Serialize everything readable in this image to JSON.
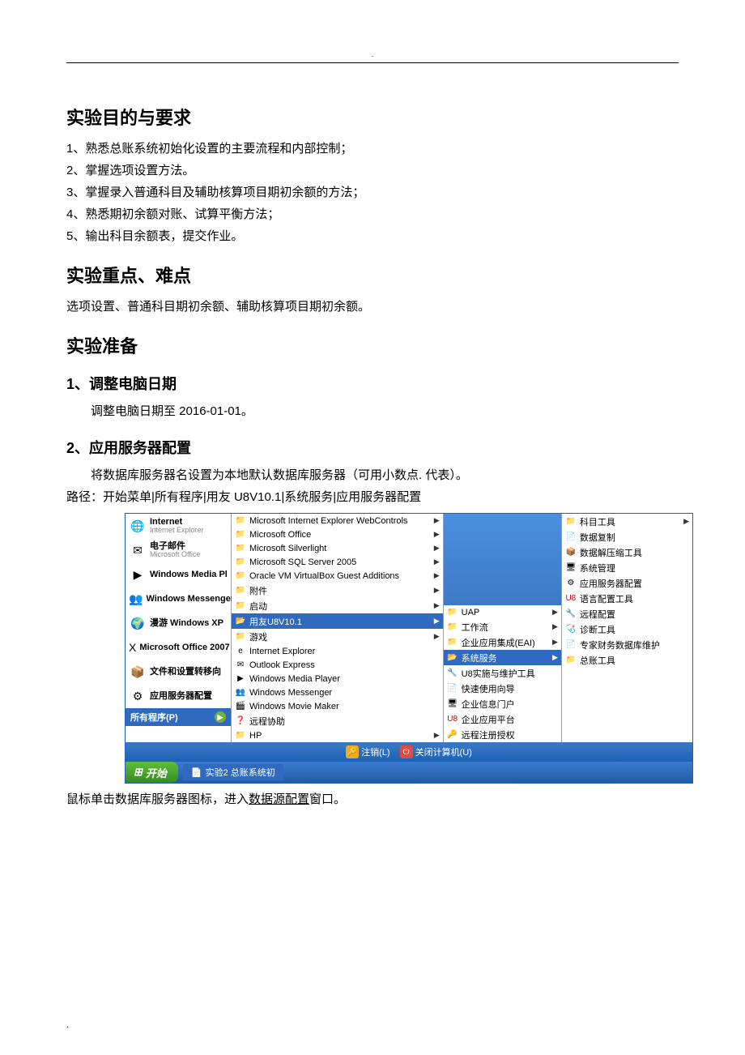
{
  "header_dot": ".",
  "doc": {
    "h1_purpose": "实验目的与要求",
    "purpose_items": [
      "1、熟悉总账系统初始化设置的主要流程和内部控制；",
      "2、掌握选项设置方法。",
      "3、掌握录入普通科目及辅助核算项目期初余额的方法；",
      "4、熟悉期初余额对账、试算平衡方法；",
      "5、输出科目余额表，提交作业。"
    ],
    "h1_focus": "实验重点、难点",
    "focus_text": "选项设置、普通科目期初余额、辅助核算项目期初余额。",
    "h1_prep": "实验准备",
    "h2_date": "1、调整电脑日期",
    "date_text": "调整电脑日期至 2016-01-01。",
    "h2_server": "2、应用服务器配置",
    "server_text1": "将数据库服务器名设置为本地默认数据库服务器（可用小数点. 代表）。",
    "server_text2": "路径：开始菜单|所有程序|用友 U8V10.1|系统服务|应用服务器配置",
    "after_img_prefix": "鼠标单击数据库服务器图标，进入",
    "after_img_link": "数据源配置",
    "after_img_suffix": "窗口。"
  },
  "startmenu": {
    "left_pinned": [
      {
        "title": "Internet",
        "sub": "Internet Explorer",
        "icon": "🌐"
      },
      {
        "title": "电子邮件",
        "sub": "Microsoft Office",
        "icon": "✉"
      },
      {
        "title": "Windows Media Pl",
        "sub": "",
        "icon": "▶"
      },
      {
        "title": "Windows Messenger",
        "sub": "",
        "icon": "👥"
      },
      {
        "title": "漫游 Windows XP",
        "sub": "",
        "icon": "🌍"
      },
      {
        "title": "Microsoft Office 2007",
        "sub": "",
        "icon": "X"
      },
      {
        "title": "文件和设置转移向",
        "sub": "",
        "icon": "📦"
      },
      {
        "title": "应用服务器配置",
        "sub": "",
        "icon": "⚙"
      }
    ],
    "all_programs": "所有程序(P)",
    "mid_items": [
      {
        "label": "Microsoft Internet Explorer WebControls",
        "icon": "📁",
        "arrow": true
      },
      {
        "label": "Microsoft Office",
        "icon": "📁",
        "arrow": true
      },
      {
        "label": "Microsoft Silverlight",
        "icon": "📁",
        "arrow": true
      },
      {
        "label": "Microsoft SQL Server 2005",
        "icon": "📁",
        "arrow": true
      },
      {
        "label": "Oracle VM VirtualBox Guest Additions",
        "icon": "📁",
        "arrow": true
      },
      {
        "label": "附件",
        "icon": "📁",
        "arrow": true
      },
      {
        "label": "启动",
        "icon": "📁",
        "arrow": true
      },
      {
        "label": "用友U8V10.1",
        "icon": "📂",
        "arrow": true,
        "selected": true
      },
      {
        "label": "游戏",
        "icon": "📁",
        "arrow": true
      },
      {
        "label": "Internet Explorer",
        "icon": "e",
        "arrow": false
      },
      {
        "label": "Outlook Express",
        "icon": "✉",
        "arrow": false
      },
      {
        "label": "Windows Media Player",
        "icon": "▶",
        "arrow": false
      },
      {
        "label": "Windows Messenger",
        "icon": "👥",
        "arrow": false
      },
      {
        "label": "Windows Movie Maker",
        "icon": "🎬",
        "arrow": false
      },
      {
        "label": "远程协助",
        "icon": "❓",
        "arrow": false
      },
      {
        "label": "HP",
        "icon": "📁",
        "arrow": true
      }
    ],
    "sub1_items": [
      {
        "label": "UAP",
        "icon": "📁",
        "arrow": true
      },
      {
        "label": "工作流",
        "icon": "📁",
        "arrow": true
      },
      {
        "label": "企业应用集成(EAI)",
        "icon": "📁",
        "arrow": true
      },
      {
        "label": "系统服务",
        "icon": "📂",
        "arrow": true,
        "selected": true
      },
      {
        "label": "U8实施与维护工具",
        "icon": "🔧",
        "arrow": false
      },
      {
        "label": "快速使用向导",
        "icon": "📄",
        "arrow": false
      },
      {
        "label": "企业信息门户",
        "icon": "🖥",
        "arrow": false
      },
      {
        "label": "企业应用平台",
        "icon": "U8",
        "arrow": false,
        "color": "#c00"
      },
      {
        "label": "远程注册授权",
        "icon": "🔑",
        "arrow": false
      }
    ],
    "sub2_items": [
      {
        "label": "科目工具",
        "icon": "📁",
        "arrow": true
      },
      {
        "label": "数据复制",
        "icon": "📄",
        "arrow": false
      },
      {
        "label": "数据解压缩工具",
        "icon": "📦",
        "arrow": false
      },
      {
        "label": "系统管理",
        "icon": "🖥",
        "arrow": false
      },
      {
        "label": "应用服务器配置",
        "icon": "⚙",
        "arrow": false
      },
      {
        "label": "语言配置工具",
        "icon": "U8",
        "arrow": false,
        "color": "#c00"
      },
      {
        "label": "远程配置",
        "icon": "🔧",
        "arrow": false
      },
      {
        "label": "诊断工具",
        "icon": "🩺",
        "arrow": false
      },
      {
        "label": "专家财务数据库维护",
        "icon": "📄",
        "arrow": false
      },
      {
        "label": "总账工具",
        "icon": "📁",
        "arrow": false
      }
    ],
    "logoff": "注销(L)",
    "shutdown": "关闭计算机(U)",
    "start_btn": "开始",
    "taskbar_item": "实验2 总账系统初"
  },
  "footer_dot": "."
}
